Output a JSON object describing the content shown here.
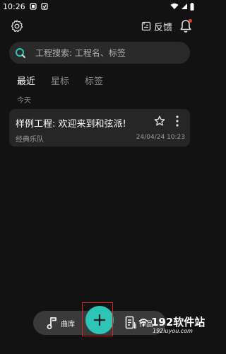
{
  "status_bar": {
    "time": "10:26",
    "indicator_icons": [
      "notification-a-icon",
      "notification-b-icon"
    ],
    "right_icons": [
      "wifi-icon",
      "signal-icon",
      "battery-icon"
    ]
  },
  "header": {
    "settings_icon": "gear-icon",
    "feedback_label": "反馈",
    "feedback_icon": "feedback-icon",
    "bell_icon": "bell-icon"
  },
  "search": {
    "placeholder": "工程搜索: 工程名、标签",
    "icon": "search-icon"
  },
  "tabs": [
    {
      "label": "最近",
      "active": true
    },
    {
      "label": "星标",
      "active": false
    },
    {
      "label": "标签",
      "active": false
    }
  ],
  "section": {
    "label": "今天"
  },
  "projects": [
    {
      "title": "样例工程: 欢迎来到和弦派!",
      "subtitle": "经典乐队",
      "date": "24/04/24 10:23",
      "star_icon": "star-outline-icon",
      "more_icon": "more-vertical-icon"
    }
  ],
  "bottom_nav": {
    "library_label": "曲库",
    "library_icon": "music-note-icon",
    "works_label": "作品",
    "works_icon": "document-list-icon",
    "add_icon": "plus-icon"
  },
  "colors": {
    "background": "#121212",
    "accent": "#2ec4b6",
    "card": "#262626",
    "highlight": "#e02020"
  },
  "watermark": {
    "text": "192软件站",
    "url": "192luyou.com"
  }
}
